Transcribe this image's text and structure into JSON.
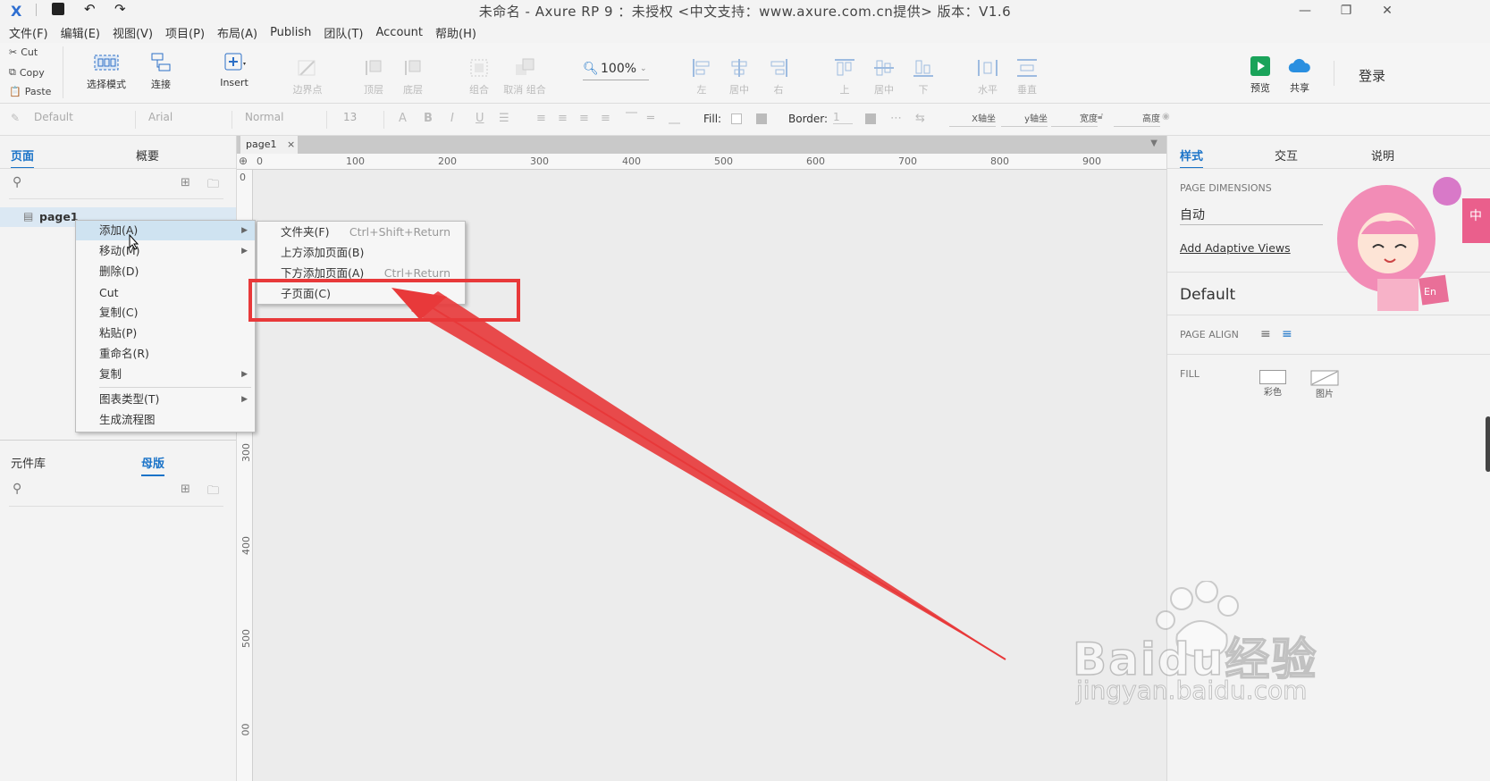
{
  "window": {
    "title": "未命名 - Axure RP 9 ：未授权  <中文支持：www.axure.com.cn提供> 版本：V1.6",
    "controls": [
      "—",
      "❐",
      "✕"
    ]
  },
  "menubar": [
    "文件(F)",
    "编辑(E)",
    "视图(V)",
    "项目(P)",
    "布局(A)",
    "Publish",
    "团队(T)",
    "Account",
    "帮助(H)"
  ],
  "clipboard": {
    "cut": "Cut",
    "copy": "Copy",
    "paste": "Paste"
  },
  "toolbar": {
    "select_mode": "选择模式",
    "connect": "连接",
    "insert": "Insert",
    "points": "边界点",
    "top": "顶层",
    "bottom": "底层",
    "group": "组合",
    "ungroup": "取消 组合",
    "zoom": "100%",
    "align_left": "左",
    "align_center": "居中",
    "align_right": "右",
    "align_top": "上",
    "align_middle": "居中",
    "align_bottom": "下",
    "dist_h": "水平",
    "dist_v": "垂直",
    "preview": "预览",
    "share": "共享",
    "login": "登录"
  },
  "formatbar": {
    "style": "Default",
    "font": "Arial",
    "weight": "Normal",
    "size": "13",
    "fill_label": "Fill:",
    "border_label": "Border:",
    "border_value": "1",
    "x_label": "X轴坐",
    "y_label": "y轴坐",
    "w_label": "宽度",
    "h_label": "高度"
  },
  "left_panel": {
    "tabs": [
      "页面",
      "概要"
    ],
    "pages": [
      "page1"
    ],
    "lib_tabs": [
      "元件库",
      "母版"
    ]
  },
  "context_menu": {
    "items": [
      {
        "label": "添加(A)",
        "sub": true
      },
      {
        "label": "移动(M)",
        "sub": true
      },
      {
        "label": "删除(D)",
        "sub": false
      },
      {
        "label": "Cut",
        "sub": false
      },
      {
        "label": "复制(C)",
        "sub": false
      },
      {
        "label": "粘贴(P)",
        "sub": false
      },
      {
        "label": "重命名(R)",
        "sub": false
      },
      {
        "label": "复制",
        "sub": true
      },
      {
        "label": "图表类型(T)",
        "sub": true
      },
      {
        "label": "生成流程图",
        "sub": false
      }
    ]
  },
  "submenu": {
    "items": [
      {
        "label": "文件夹(F)",
        "shortcut": "Ctrl+Shift+Return"
      },
      {
        "label": "上方添加页面(B)",
        "shortcut": ""
      },
      {
        "label": "下方添加页面(A)",
        "shortcut": "Ctrl+Return"
      },
      {
        "label": "子页面(C)",
        "shortcut": ""
      }
    ]
  },
  "canvas": {
    "tab": "page1",
    "ruler_h": [
      "0",
      "100",
      "200",
      "300",
      "400",
      "500",
      "600",
      "700",
      "800",
      "900"
    ],
    "ruler_v": [
      "0",
      "300",
      "400",
      "500",
      "00"
    ]
  },
  "right_panel": {
    "tabs": [
      "样式",
      "交互",
      "说明"
    ],
    "page_dimensions_label": "PAGE DIMENSIONS",
    "page_dimensions_value": "自动",
    "add_adaptive": "Add Adaptive Views",
    "style_name": "Default",
    "page_align_label": "PAGE ALIGN",
    "fill_label": "FILL",
    "fill_color": "彩色",
    "fill_image": "图片"
  },
  "watermark": {
    "brand": "Baidu经验",
    "url": "jingyan.baidu.com"
  },
  "colors": {
    "accent": "#1a73c8",
    "highlight": "#cfe3f1",
    "annotation": "#e8393a"
  }
}
